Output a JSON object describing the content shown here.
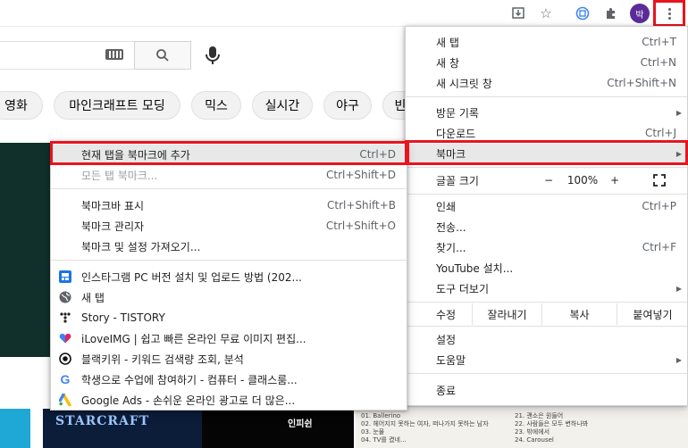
{
  "toolbar": {
    "avatar_text": "박",
    "icons": [
      "install-app-icon",
      "star-icon",
      "extension-circle-icon",
      "puzzle-icon",
      "kebab-menu-icon"
    ]
  },
  "chips": [
    "영화",
    "마인크래프트 모딩",
    "믹스",
    "실시간",
    "야구",
    "빈"
  ],
  "main_menu": {
    "new_tab": "새 탭",
    "new_tab_sc": "Ctrl+T",
    "new_window": "새 창",
    "new_window_sc": "Ctrl+N",
    "incognito": "새 시크릿 창",
    "incognito_sc": "Ctrl+Shift+N",
    "history": "방문 기록",
    "downloads": "다운로드",
    "downloads_sc": "Ctrl+J",
    "bookmarks": "북마크",
    "zoom_label": "글꼴 크기",
    "zoom_minus": "−",
    "zoom_value": "100%",
    "zoom_plus": "+",
    "print": "인쇄",
    "print_sc": "Ctrl+P",
    "cast": "전송...",
    "find": "찾기...",
    "find_sc": "Ctrl+F",
    "youtube_install": "YouTube 설치...",
    "more_tools": "도구 더보기",
    "edit_label": "수정",
    "cut": "잘라내기",
    "copy": "복사",
    "paste": "붙여넣기",
    "settings": "설정",
    "help": "도움말",
    "exit": "종료"
  },
  "bookmark_menu": {
    "add_bookmark": "현재 탭을 북마크에 추가",
    "add_bookmark_sc": "Ctrl+D",
    "bookmark_all": "모든 탭 북마크...",
    "bookmark_all_sc": "Ctrl+Shift+D",
    "show_bar": "북마크바 표시",
    "show_bar_sc": "Ctrl+Shift+B",
    "manager": "북마크 관리자",
    "manager_sc": "Ctrl+Shift+O",
    "import": "북마크 및 설정 가져오기...",
    "items": [
      {
        "label": "인스타그램 PC 버전 설치 및 업로드 방법 (202...",
        "icon": "blue-square-icon"
      },
      {
        "label": "새 탭",
        "icon": "globe-icon"
      },
      {
        "label": "Story - TISTORY",
        "icon": "tistory-icon"
      },
      {
        "label": "iLoveIMG | 쉽고 빠른 온라인 무료 이미지 편집...",
        "icon": "heart-icon"
      },
      {
        "label": "블랙키위 - 키워드 검색량 조회, 분석",
        "icon": "record-icon"
      },
      {
        "label": "학생으로 수업에 참여하기 - 컴퓨터 - 클래스룸...",
        "icon": "google-g-icon"
      },
      {
        "label": "Google Ads - 손쉬운 온라인 광고로 더 많은...",
        "icon": "google-ads-icon"
      }
    ]
  },
  "thumbnails": {
    "starcraft_text": "STARCRAFT",
    "infinite_text": "인피쉰",
    "playlist_left": [
      "01. Ballerino",
      "02. 헤어지지 못하는 여자, 떠나가지 못하는 남자",
      "03. 눈물",
      "04. TV를 켰네..."
    ],
    "playlist_right": [
      "21. 괜소은 원들어",
      "22. 사람들은 모두 변하나봐",
      "23. 밖에에서",
      "24. Carousel"
    ]
  },
  "colors": {
    "highlight_red": "#e8141e",
    "avatar_purple": "#5b2b9a",
    "menu_selected_bg": "#e8e8e8"
  }
}
